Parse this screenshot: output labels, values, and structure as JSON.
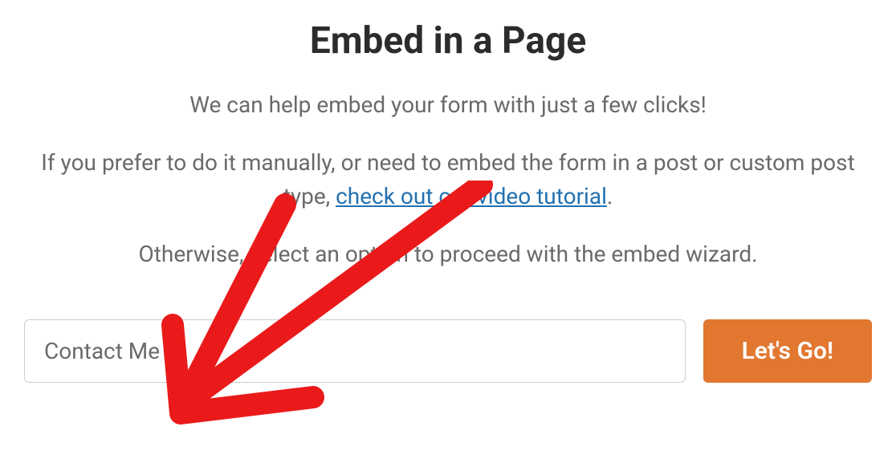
{
  "heading": "Embed in a Page",
  "description": {
    "line1": "We can help embed your form with just a few clicks!",
    "line2_prefix": "If you prefer to do it manually, or need to embed the form in a post or custom post type, ",
    "link_text": "check out our video tutorial",
    "line2_suffix": ".",
    "line3": "Otherwise, select an option to proceed with the embed wizard."
  },
  "form": {
    "input_value": "Contact Me",
    "button_label": "Let's Go!"
  },
  "colors": {
    "accent": "#e27730",
    "link": "#2271b1",
    "text_muted": "#6a6a6a",
    "heading": "#2c2c2c",
    "annotation": "#ea1a1a"
  }
}
